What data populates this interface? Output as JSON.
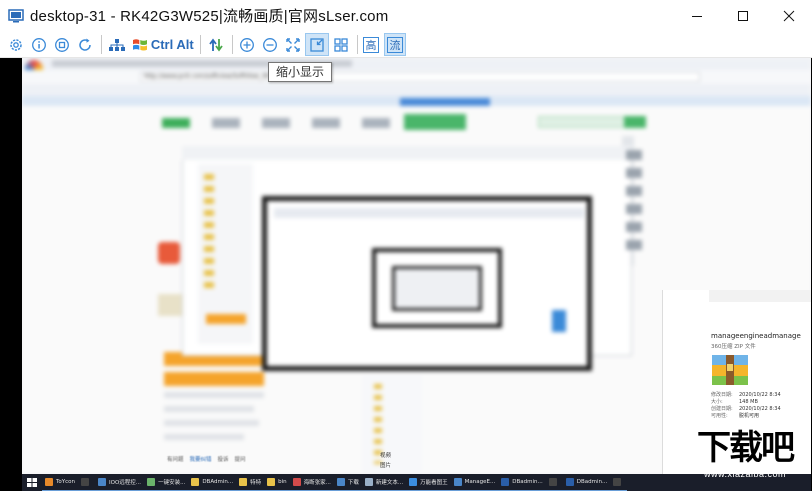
{
  "window": {
    "title": "desktop-31 - RK42G3W525|流畅画质|官网sLser.com"
  },
  "toolbar": {
    "buttons": [
      {
        "name": "settings-icon",
        "label": ""
      },
      {
        "name": "info-icon",
        "label": ""
      },
      {
        "name": "stop-icon",
        "label": ""
      },
      {
        "name": "refresh-icon",
        "label": ""
      },
      {
        "name": "network-icon",
        "label": ""
      },
      {
        "name": "windows-key-icon",
        "label": ""
      },
      {
        "name": "ctrl-key",
        "label": "Ctrl"
      },
      {
        "name": "alt-key",
        "label": "Alt"
      },
      {
        "name": "transfer-icon",
        "label": ""
      },
      {
        "name": "zoom-in-icon",
        "label": ""
      },
      {
        "name": "zoom-out-icon",
        "label": ""
      },
      {
        "name": "fit-screen-icon",
        "label": ""
      },
      {
        "name": "shrink-display-icon",
        "label": ""
      },
      {
        "name": "fullscreen-icon",
        "label": ""
      },
      {
        "name": "quality-high-icon",
        "label": "高"
      },
      {
        "name": "quality-smooth-icon",
        "label": "流"
      }
    ],
    "tooltip": "缩小显示"
  },
  "remote": {
    "browser_url": "http://www.pc6.com/softview/SoftView_69",
    "file_name": "manageengineadmanage",
    "file_type": "360压缩 ZIP 文件",
    "file_size": "148 MB",
    "file_date_modified": "2020/10/22 8:34",
    "file_date_created": "2020/10/22 8:34",
    "file_labels": [
      "修改日期:",
      "大小:",
      "创建日期:",
      "可用性:"
    ],
    "file_availability": "脱机可用",
    "folder_item_1": "视频",
    "folder_item_2": "图片",
    "status_left": "有问题",
    "status_links": [
      "我要纠错",
      "投诉",
      "提问"
    ],
    "taskbar": [
      {
        "label": "ToYcon",
        "color": "#e88a2a"
      },
      {
        "label": "",
        "color": "#444"
      },
      {
        "label": "IOO远程控...",
        "color": "#4a86c8"
      },
      {
        "label": "一键安装...",
        "color": "#6bb36b"
      },
      {
        "label": "DBAdmin...",
        "color": "#e8c24a"
      },
      {
        "label": "特特",
        "color": "#e8c24a"
      },
      {
        "label": "bin",
        "color": "#e8c24a"
      },
      {
        "label": "海断张家...",
        "color": "#d24b4b"
      },
      {
        "label": "下载",
        "color": "#4a86c8"
      },
      {
        "label": "新建文本...",
        "color": "#9ab0c8"
      },
      {
        "label": "万能看图王",
        "color": "#3b8ee0"
      },
      {
        "label": "ManageE...",
        "color": "#4a86c8"
      },
      {
        "label": "DBadmin...",
        "color": "#2a5ea8"
      },
      {
        "label": "",
        "color": "#444"
      },
      {
        "label": "DBadmin...",
        "color": "#2a5ea8"
      },
      {
        "label": "",
        "color": "#444"
      }
    ]
  },
  "watermark": {
    "title": "下载吧",
    "url": "www.xiazaiba.com"
  }
}
